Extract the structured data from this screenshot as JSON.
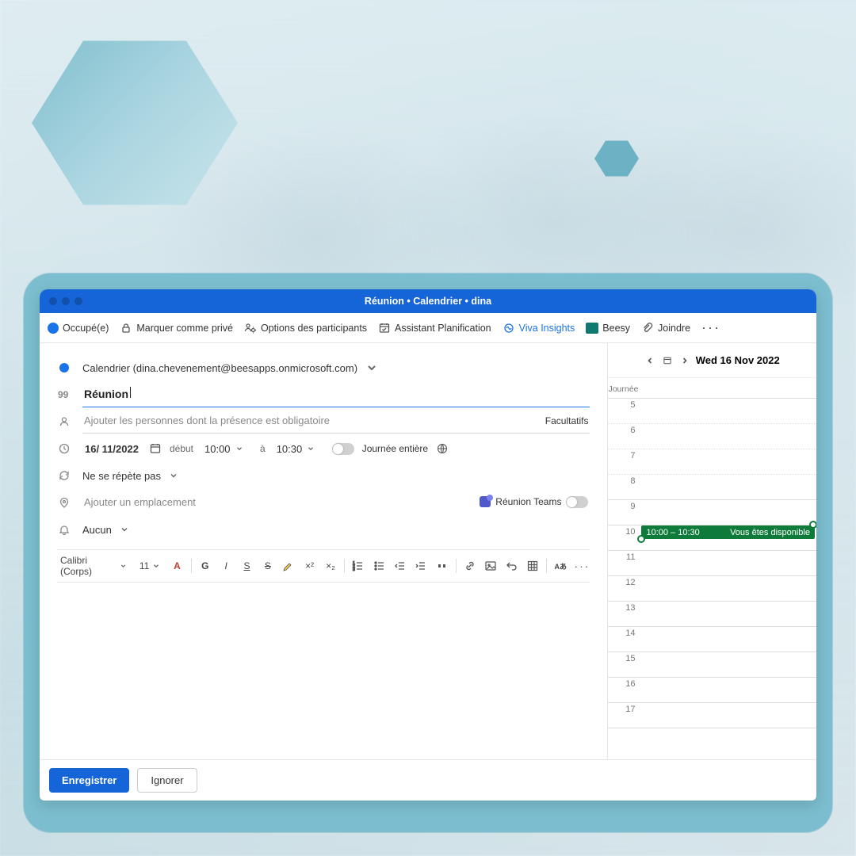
{
  "titlebar": {
    "title": "Réunion  •  Calendrier  •  dina"
  },
  "toolbar": {
    "status": "Occupé(e)",
    "private": "Marquer comme privé",
    "options": "Options des participants",
    "assistant": "Assistant Planification",
    "viva": "Viva Insights",
    "beesy": "Beesy",
    "attach": "Joindre"
  },
  "form": {
    "calendar_line": "Calendrier (dina.chevenement@beesapps.onmicrosoft.com)",
    "subject": "Réunion",
    "attendees_placeholder": "Ajouter les personnes dont la présence est obligatoire",
    "optional_label": "Facultatifs",
    "date": "16/ 11/2022",
    "start_label": "début",
    "start_time": "10:00",
    "to_label": "à",
    "end_time": "10:30",
    "allday_label": "Journée entière",
    "repeat": "Ne se répète pas",
    "location_placeholder": "Ajouter un emplacement",
    "teams_label": "Réunion Teams",
    "reminder": "Aucun"
  },
  "format": {
    "font": "Calibri (Corps)",
    "size": "11"
  },
  "footer": {
    "save": "Enregistrer",
    "discard": "Ignorer"
  },
  "side": {
    "date": "Wed 16 Nov 2022",
    "allday": "Journée",
    "hours": [
      "5",
      "6",
      "7",
      "8",
      "9",
      "10",
      "11",
      "12",
      "13",
      "14",
      "15",
      "16",
      "17"
    ],
    "event_time": "10:00 – 10:30",
    "event_avail": "Vous êtes disponible"
  }
}
